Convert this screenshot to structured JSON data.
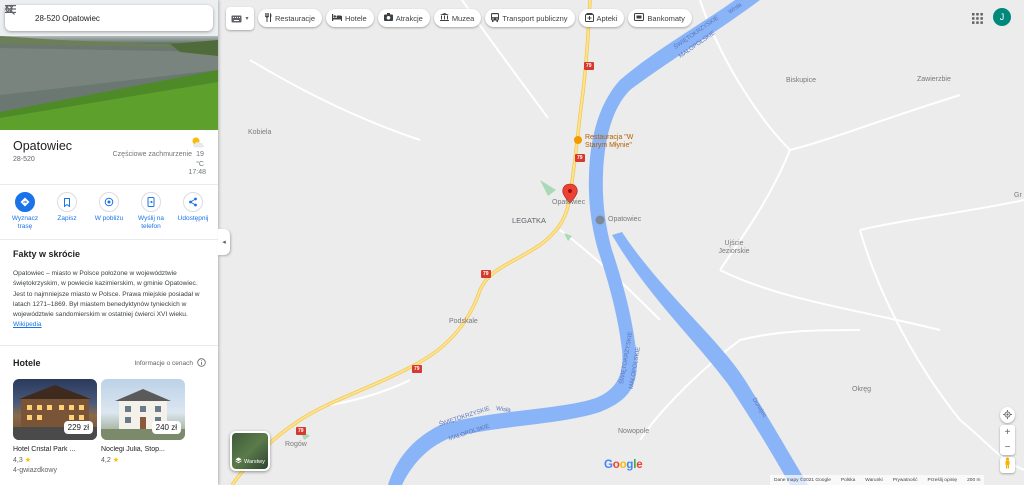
{
  "search": {
    "query": "28-520 Opatowiec"
  },
  "place": {
    "name": "Opatowiec",
    "postal": "28-520",
    "weather_condition": "Częściowe zachmurzenie",
    "weather_temp": "19 °C",
    "weather_time": "17:48"
  },
  "actions": [
    {
      "label": "Wyznacz trasę",
      "icon": "directions-icon"
    },
    {
      "label": "Zapisz",
      "icon": "bookmark-icon"
    },
    {
      "label": "W pobliżu",
      "icon": "nearby-icon"
    },
    {
      "label": "Wyślij na telefon",
      "icon": "send-to-phone-icon"
    },
    {
      "label": "Udostępnij",
      "icon": "share-icon"
    }
  ],
  "facts": {
    "heading": "Fakty w skrócie",
    "text": "Opatowiec – miasto w Polsce położone w województwie świętokrzyskim, w powiecie kazimierskim, w gminie Opatowiec. Jest to najmniejsze miasto w Polsce. Prawa miejskie posiadał w latach 1271–1869. Był miastem benedyktynów tynieckich w województwie sandomierskim w ostatniej ćwierci XVI wieku.",
    "link": "Wikipedia"
  },
  "hotels": {
    "heading": "Hotele",
    "price_info": "Informacje o cenach",
    "items": [
      {
        "name": "Hotel Cristal Park ...",
        "price": "229 zł",
        "rating": "4,3",
        "class": "4-gwiazdkowy"
      },
      {
        "name": "Noclegi Julia, Stop...",
        "price": "240 zł",
        "rating": "4,2",
        "class": ""
      }
    ]
  },
  "chips": [
    {
      "label": "Restauracje",
      "icon": "fork-knife-icon"
    },
    {
      "label": "Hotele",
      "icon": "bed-icon"
    },
    {
      "label": "Atrakcje",
      "icon": "camera-icon"
    },
    {
      "label": "Muzea",
      "icon": "museum-icon"
    },
    {
      "label": "Transport publiczny",
      "icon": "bus-icon"
    },
    {
      "label": "Apteki",
      "icon": "pharmacy-icon"
    },
    {
      "label": "Bankomaty",
      "icon": "atm-icon"
    }
  ],
  "user": {
    "initial": "J"
  },
  "map": {
    "labels": {
      "biskupice": "Biskupice",
      "zawierzbie": "Zawierzbie",
      "kobiela": "Kobiela",
      "legatka": "LEGATKA",
      "opatowiec_marker": "Opatowiec",
      "opatowiec_town": "Opatowiec",
      "restaurant": "Restauracja \"W Starym Młynie\"",
      "ujscie": "Ujście Jeziorskie",
      "podskale": "Podskale",
      "okreg": "Okręg",
      "nowopole": "Nowopole",
      "rogow": "Rogów",
      "gr": "Gr"
    },
    "river_labels": {
      "wisla_top": "Wisła",
      "swietokrzyskie_top": "ŚWIĘTOKRZYSKIE",
      "malopolskie_top": "MAŁOPOLSKIE",
      "dunajec": "Dunajec",
      "swietokrzyskie_mid": "ŚWIĘTOKRZYSKIE",
      "malopolskie_mid": "MAŁOPOLSKIE",
      "wisla_bottom": "Wisła",
      "swietokrzyskie_bot": "ŚWIĘTOKRZYSKIE",
      "malopolskie_bot": "MAŁOPOLSKIE"
    },
    "road_number": "79",
    "layers_label": "Warstwy",
    "google": "Google"
  },
  "footer": [
    "Dane mapy ©2021 Google",
    "Polska",
    "Warunki",
    "Prywatność",
    "Prześlij opinię",
    "200 m"
  ]
}
